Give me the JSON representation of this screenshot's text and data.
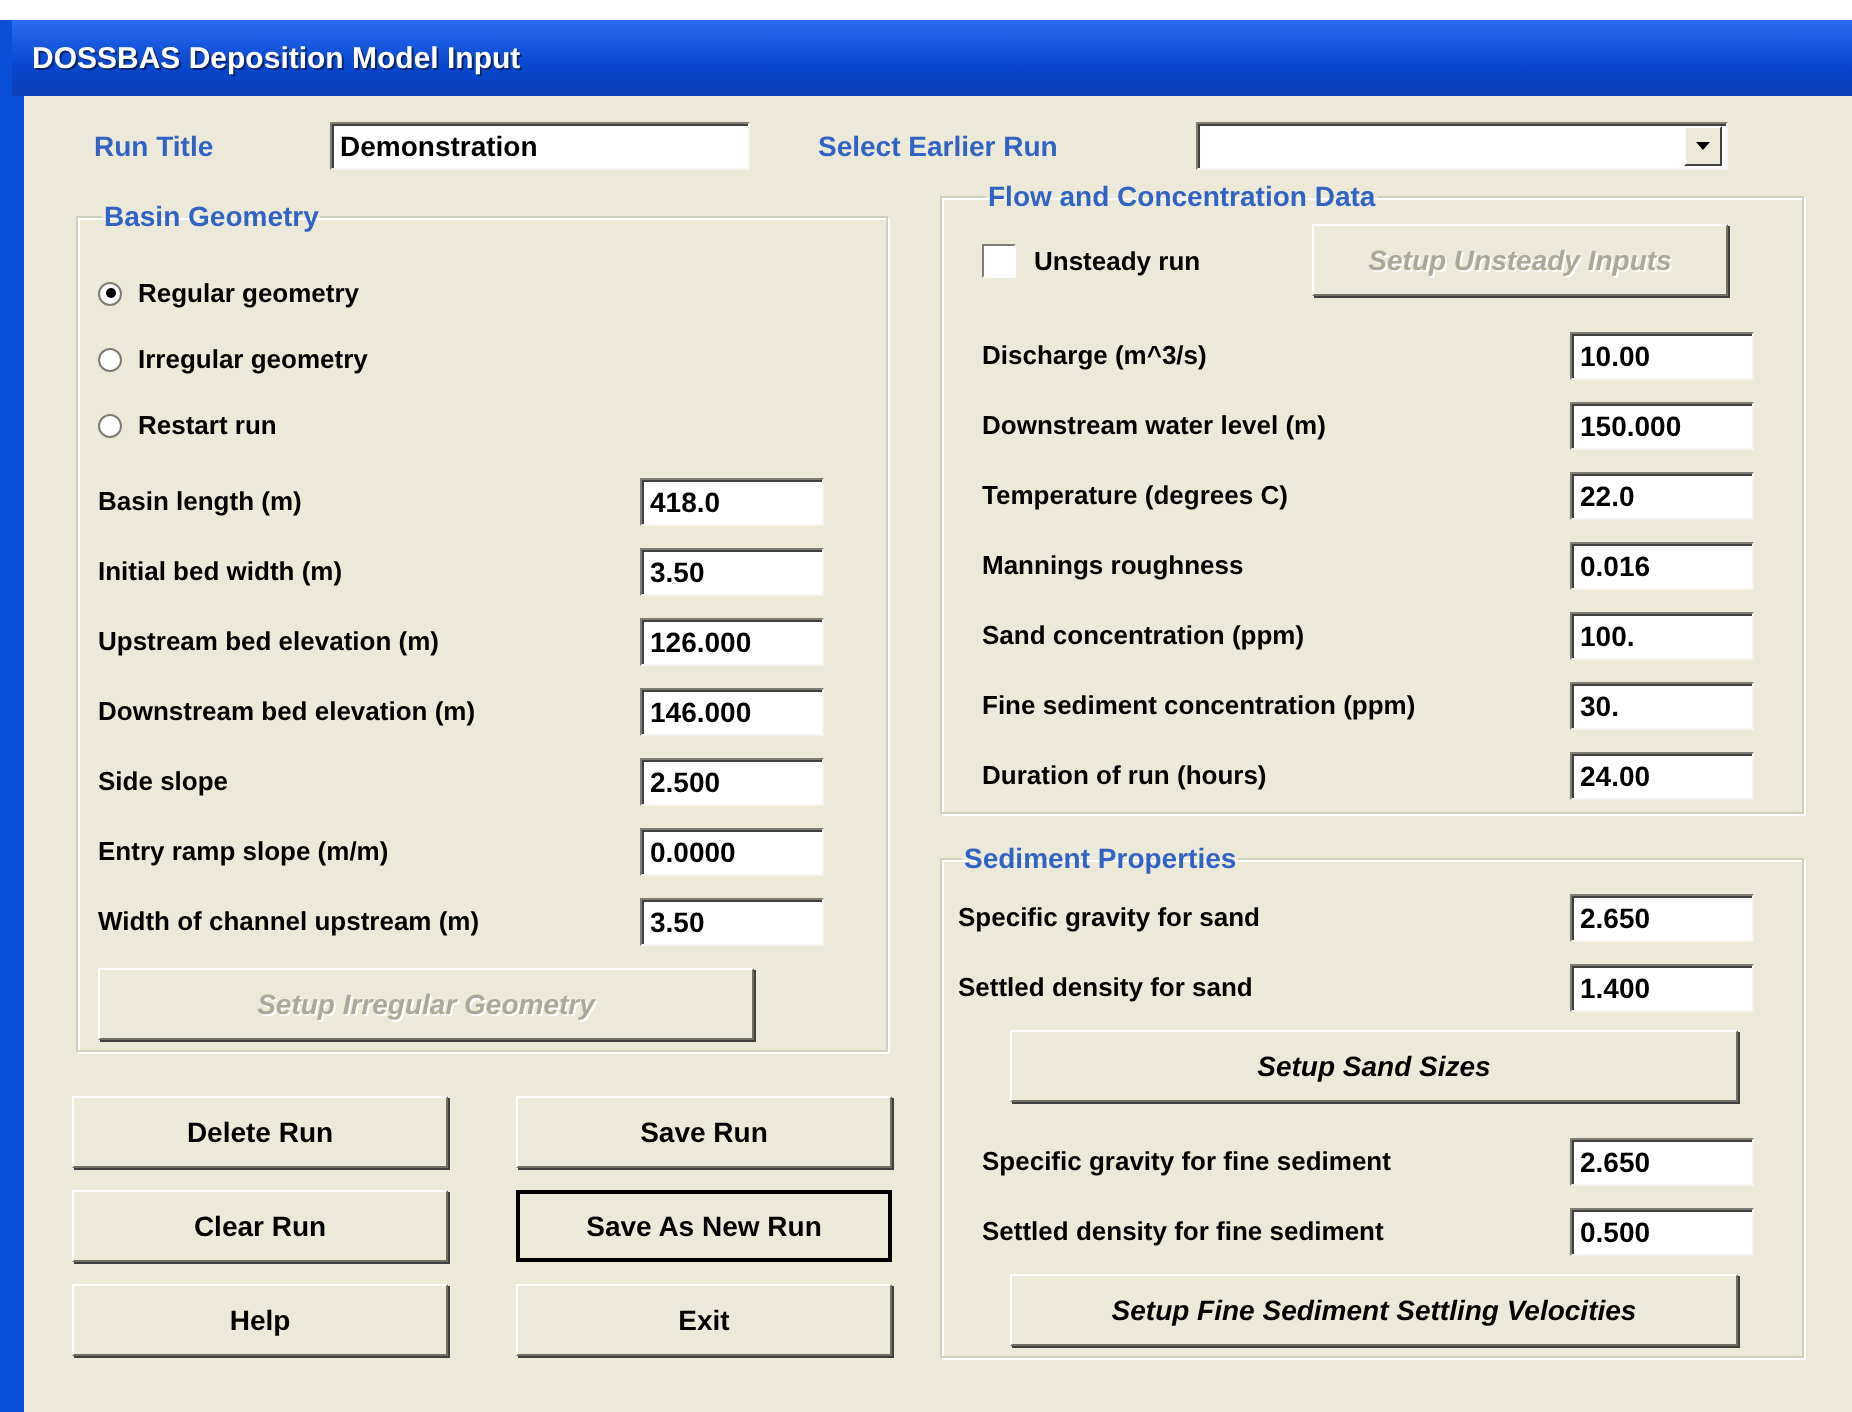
{
  "window": {
    "title": "DOSSBAS Deposition Model Input"
  },
  "run_title": {
    "label": "Run Title",
    "value": "Demonstration"
  },
  "earlier_run": {
    "label": "Select Earlier Run"
  },
  "basin_geometry": {
    "title": "Basin Geometry",
    "options": [
      {
        "label": "Regular geometry",
        "selected": true
      },
      {
        "label": "Irregular geometry",
        "selected": false
      },
      {
        "label": "Restart run",
        "selected": false
      }
    ],
    "fields": [
      {
        "label": "Basin length (m)",
        "value": "418.0"
      },
      {
        "label": "Initial bed width (m)",
        "value": "3.50"
      },
      {
        "label": "Upstream bed elevation (m)",
        "value": "126.000"
      },
      {
        "label": "Downstream bed elevation (m)",
        "value": "146.000"
      },
      {
        "label": "Side slope",
        "value": "2.500"
      },
      {
        "label": "Entry ramp slope (m/m)",
        "value": "0.0000"
      },
      {
        "label": "Width of channel upstream (m)",
        "value": "3.50"
      }
    ],
    "button": {
      "label": "Setup Irregular Geometry",
      "disabled": true
    }
  },
  "flow": {
    "title": "Flow and Concentration Data",
    "unsteady": {
      "label": "Unsteady run",
      "checked": false
    },
    "button": {
      "label": "Setup Unsteady Inputs",
      "disabled": true
    },
    "fields": [
      {
        "label": "Discharge (m^3/s)",
        "value": "10.00"
      },
      {
        "label": "Downstream water level (m)",
        "value": "150.000"
      },
      {
        "label": "Temperature (degrees C)",
        "value": "22.0"
      },
      {
        "label": "Mannings roughness",
        "value": "0.016"
      },
      {
        "label": "Sand concentration (ppm)",
        "value": "100."
      },
      {
        "label": "Fine sediment concentration (ppm)",
        "value": "30."
      },
      {
        "label": "Duration of run (hours)",
        "value": "24.00"
      }
    ]
  },
  "sediment": {
    "title": "Sediment Properties",
    "items": [
      {
        "kind": "field",
        "label": "Specific gravity for sand",
        "value": "2.650"
      },
      {
        "kind": "field",
        "label": "Settled density for sand",
        "value": "1.400"
      },
      {
        "kind": "button",
        "label": "Setup Sand Sizes",
        "disabled": false
      },
      {
        "kind": "field",
        "label": "Specific gravity for fine sediment",
        "value": "2.650"
      },
      {
        "kind": "field",
        "label": "Settled density for fine sediment",
        "value": "0.500"
      },
      {
        "kind": "button",
        "label": "Setup Fine Sediment Settling Velocities",
        "disabled": false
      }
    ]
  },
  "buttons": [
    {
      "label": "Delete Run",
      "default": false
    },
    {
      "label": "Save Run",
      "default": false
    },
    {
      "label": "Clear Run",
      "default": false
    },
    {
      "label": "Save As New Run",
      "default": true
    },
    {
      "label": "Help",
      "default": false
    },
    {
      "label": "Exit",
      "default": false
    }
  ]
}
